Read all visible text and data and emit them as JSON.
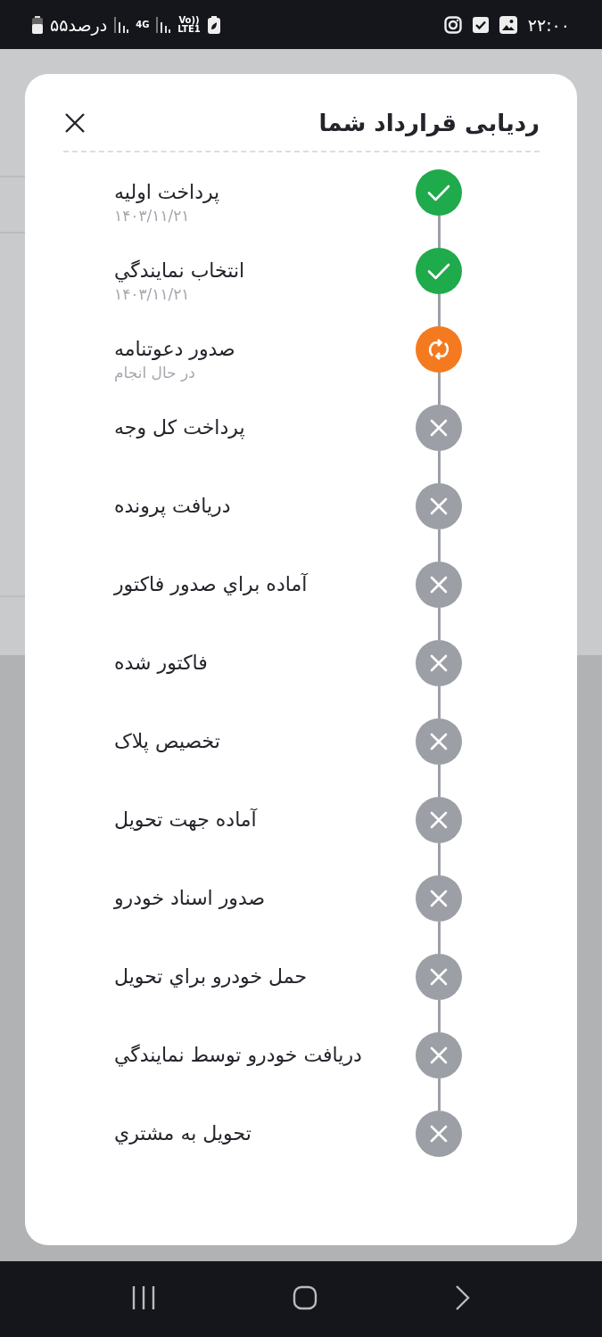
{
  "status_bar": {
    "time": "۲۲:۰۰",
    "battery_text": "۵۵درصد",
    "network_type": "4G",
    "volte": "Vo))",
    "lte": "LTE1"
  },
  "modal": {
    "title": "ردیابی قرارداد شما",
    "steps": [
      {
        "title": "پرداخت اولیه",
        "subtitle": "۱۴۰۳/۱۱/۲۱",
        "kind": "done"
      },
      {
        "title": "انتخاب نمایندگي",
        "subtitle": "۱۴۰۳/۱۱/۲۱",
        "kind": "done"
      },
      {
        "title": "صدور دعوتنامه",
        "subtitle": "در حال انجام",
        "kind": "in_progress"
      },
      {
        "title": "پرداخت کل وجه",
        "kind": "pending"
      },
      {
        "title": "دریافت پرونده",
        "kind": "pending"
      },
      {
        "title": "آماده براي صدور فاکتور",
        "kind": "pending"
      },
      {
        "title": "فاکتور شده",
        "kind": "pending"
      },
      {
        "title": "تخصیص پلاک",
        "kind": "pending"
      },
      {
        "title": "آماده جهت تحویل",
        "kind": "pending"
      },
      {
        "title": "صدور اسناد خودرو",
        "kind": "pending"
      },
      {
        "title": "حمل خودرو براي تحویل",
        "kind": "pending"
      },
      {
        "title": "دریافت خودرو توسط نمایندگي",
        "kind": "pending"
      },
      {
        "title": "تحویل به مشتري",
        "kind": "pending"
      }
    ]
  }
}
